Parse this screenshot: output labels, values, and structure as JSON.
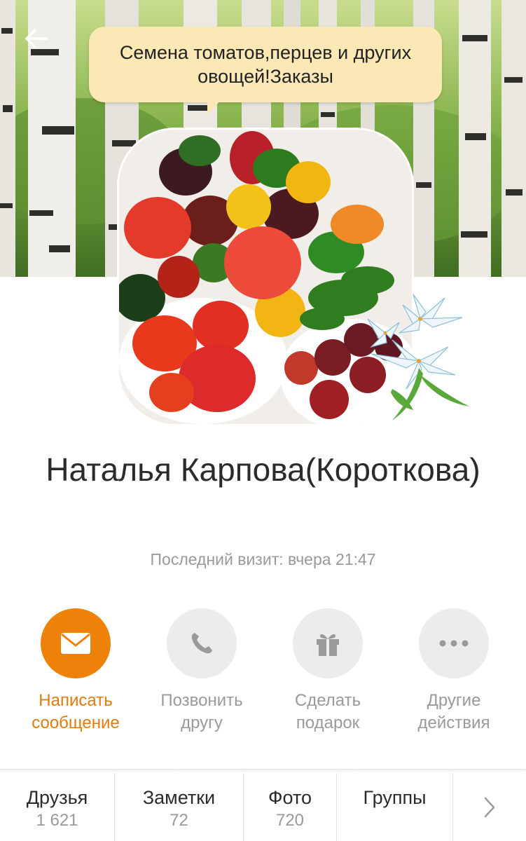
{
  "header": {
    "back_icon": "arrow-left-icon",
    "status": "Семена томатов,перцев и других овощей!Заказы"
  },
  "profile": {
    "name": "Наталья Карпова(Короткова)",
    "last_visit": "Последний визит: вчера 21:47"
  },
  "actions": [
    {
      "label": "Написать сообщение",
      "icon": "envelope-icon",
      "primary": true
    },
    {
      "label": "Позвонить другу",
      "icon": "phone-icon",
      "primary": false
    },
    {
      "label": "Сделать подарок",
      "icon": "gift-icon",
      "primary": false
    },
    {
      "label": "Другие действия",
      "icon": "more-dots-icon",
      "primary": false
    }
  ],
  "tabs": [
    {
      "label": "Друзья",
      "count": "1 621"
    },
    {
      "label": "Заметки",
      "count": "72"
    },
    {
      "label": "Фото",
      "count": "720"
    },
    {
      "label": "Группы",
      "count": ""
    }
  ],
  "colors": {
    "accent": "#ee8208",
    "accent_text": "#e07b0b",
    "status_bubble": "#fbe8b5",
    "muted_text": "#9a9a9a"
  }
}
